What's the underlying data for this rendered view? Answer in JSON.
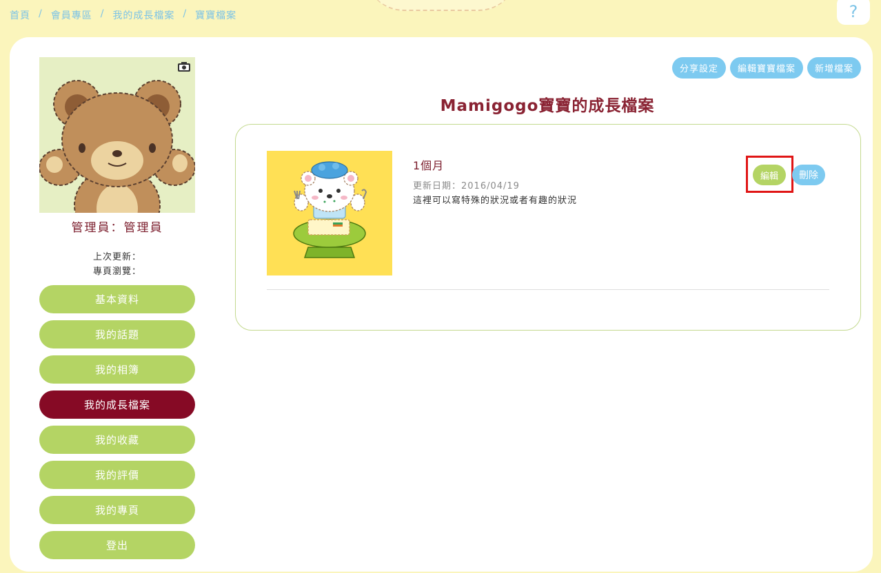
{
  "breadcrumb": [
    "首頁",
    "會員專區",
    "我的成長檔案",
    "寶寶檔案"
  ],
  "breadcrumb_sep": "/",
  "help_label": "?",
  "profile": {
    "admin_label": "管理員：管理員",
    "last_update_label": "上次更新：",
    "page_views_label": "專頁瀏覽："
  },
  "nav": [
    {
      "label": "基本資料",
      "active": false
    },
    {
      "label": "我的話題",
      "active": false
    },
    {
      "label": "我的相簿",
      "active": false
    },
    {
      "label": "我的成長檔案",
      "active": true
    },
    {
      "label": "我的收藏",
      "active": false
    },
    {
      "label": "我的評價",
      "active": false
    },
    {
      "label": "我的專頁",
      "active": false
    },
    {
      "label": "登出",
      "active": false
    }
  ],
  "actions": {
    "share": "分享設定",
    "edit_profile": "編輯寶寶檔案",
    "add_record": "新增檔案"
  },
  "page_title": "Mamigogo寶寶的成長檔案",
  "record": {
    "title": "1個月",
    "date": "更新日期：2016/04/19",
    "description": "這裡可以寫特殊的狀況或者有趣的狀況",
    "edit_label": "編輯",
    "delete_label": "刪除"
  },
  "colors": {
    "background": "#fbf5bc",
    "green": "#b4d464",
    "blue": "#7dcaf0",
    "active": "#860a25",
    "title": "#8a2333",
    "highlight": "#e01515"
  },
  "icons": {
    "camera": "camera-icon",
    "bear": "teddy-bear-avatar",
    "thumb": "bear-in-highchair-illustration"
  }
}
